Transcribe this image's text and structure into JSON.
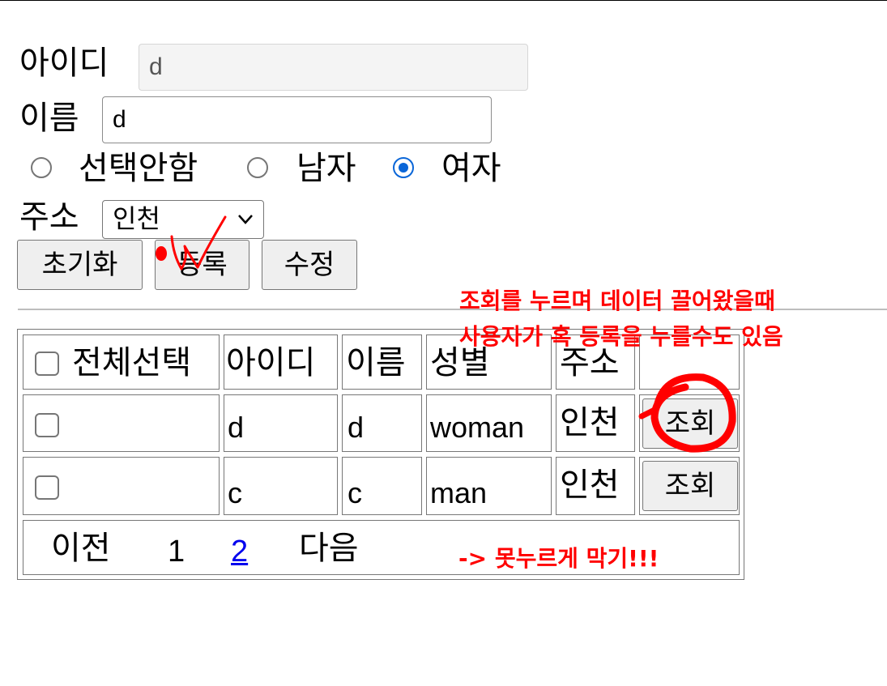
{
  "form": {
    "id_label": "아이디",
    "id_value": "d",
    "name_label": "이름",
    "name_value": "d",
    "gender_options": [
      {
        "label": "선택안함",
        "selected": false
      },
      {
        "label": "남자",
        "selected": false
      },
      {
        "label": "여자",
        "selected": true
      }
    ],
    "address_label": "주소",
    "address_value": "인천",
    "buttons": {
      "reset": "초기화",
      "register": "등록",
      "modify": "수정"
    }
  },
  "table": {
    "headers": {
      "select_all": "전체선택",
      "id": "아이디",
      "name": "이름",
      "gender": "성별",
      "address": "주소"
    },
    "rows": [
      {
        "id": "d",
        "name": "d",
        "gender": "woman",
        "address": "인천",
        "button": "조회"
      },
      {
        "id": "c",
        "name": "c",
        "gender": "man",
        "address": "인천",
        "button": "조회"
      }
    ],
    "pagination": {
      "prev": "이전",
      "page1": "1",
      "page2": "2",
      "next": "다음"
    }
  },
  "annotations": {
    "note_line1": "조회를 누르며 데이터 끌어왔을때",
    "note_line2": "사용자가 혹 등록을 누를수도 있음",
    "note_block": "-> 못누르게 막기!!!",
    "ink_color": "#ff0000"
  },
  "colors": {
    "radio_accent": "#0a66d8",
    "link": "#0000ee"
  }
}
